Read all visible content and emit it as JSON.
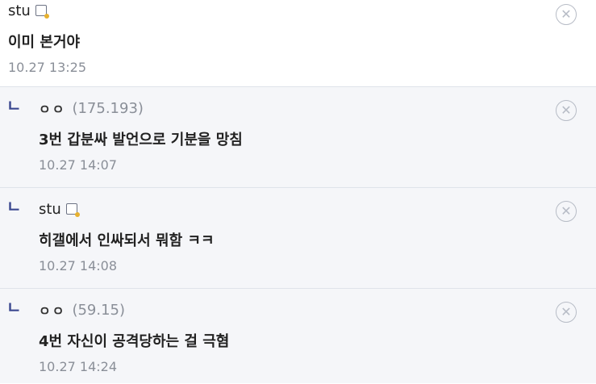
{
  "comments": [
    {
      "author": "stu",
      "ip": "",
      "text": "이미 본거야",
      "time": "10.27 13:25"
    },
    {
      "author": "ㅇㅇ",
      "ip": "(175.193)",
      "text": "3번 갑분싸 발언으로 기분을 망침",
      "time": "10.27 14:07"
    },
    {
      "author": "stu",
      "ip": "",
      "text": "히갤에서 인싸되서 뭐함 ㅋㅋ",
      "time": "10.27 14:08"
    },
    {
      "author": "ㅇㅇ",
      "ip": "(59.15)",
      "text": "4번 자신이 공격당하는 걸 극혐",
      "time": "10.27 14:24"
    }
  ],
  "icons": {
    "reply_mark": "ㄴ",
    "delete": "✕",
    "memo": "memo-icon",
    "accent_color": "#3b4890"
  }
}
